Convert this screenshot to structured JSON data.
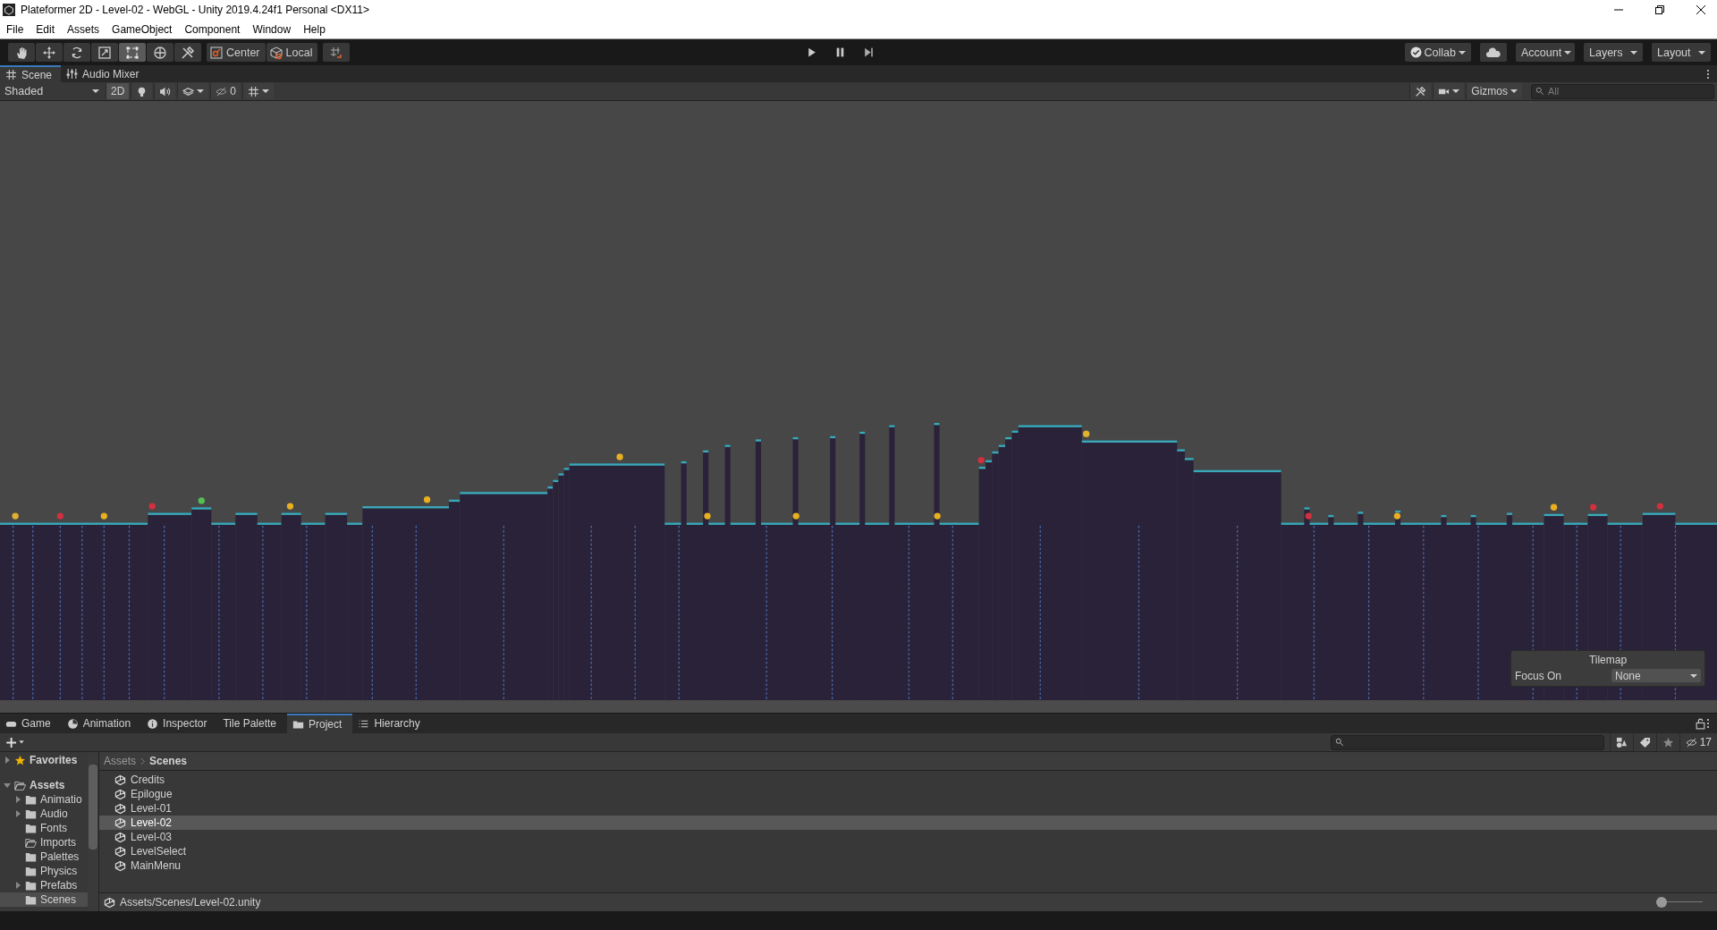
{
  "window": {
    "title": "Plateformer 2D - Level-02 - WebGL - Unity 2019.4.24f1 Personal <DX11>"
  },
  "menu": [
    "File",
    "Edit",
    "Assets",
    "GameObject",
    "Component",
    "Window",
    "Help"
  ],
  "tools": [
    {
      "kind": "hand",
      "selected": false
    },
    {
      "kind": "move",
      "selected": false
    },
    {
      "kind": "rotate",
      "selected": false
    },
    {
      "kind": "scale",
      "selected": false
    },
    {
      "kind": "rect",
      "selected": true
    },
    {
      "kind": "transform",
      "selected": false
    },
    {
      "kind": "custom",
      "selected": false
    }
  ],
  "pivot": [
    {
      "kind": "center",
      "label": "Center"
    },
    {
      "kind": "local",
      "label": "Local"
    }
  ],
  "right_buttons": [
    {
      "kind": "collab",
      "label": "Collab"
    },
    {
      "kind": "cloud"
    },
    {
      "kind": "dropdown",
      "label": "Account"
    },
    {
      "kind": "dropdown",
      "label": "Layers"
    },
    {
      "kind": "dropdown",
      "label": "Layout"
    }
  ],
  "scene_tabs": [
    {
      "kind": "scene",
      "label": "Scene",
      "selected": true
    },
    {
      "kind": "mixer",
      "label": "Audio Mixer",
      "selected": false
    }
  ],
  "scene_toolbar": {
    "draw_mode": "Shaded",
    "mode_2d": {
      "label": "2D",
      "on": true
    },
    "hidden_count": "0",
    "gizmos": "Gizmos",
    "search": {
      "placeholder": "All"
    }
  },
  "tilemap_overlay": {
    "title": "Tilemap",
    "label": "Focus On",
    "value": "None"
  },
  "bottom_tabs": [
    {
      "kind": "game",
      "label": "Game",
      "selected": false
    },
    {
      "kind": "animation",
      "label": "Animation",
      "selected": false
    },
    {
      "kind": "inspector",
      "label": "Inspector",
      "selected": false
    },
    {
      "kind": "none",
      "label": "Tile Palette",
      "selected": false
    },
    {
      "kind": "project",
      "label": "Project",
      "selected": true
    },
    {
      "kind": "hierarchy",
      "label": "Hierarchy",
      "selected": false
    }
  ],
  "project": {
    "hidden_count": "17",
    "favorites": {
      "label": "Favorites",
      "expanded": false
    },
    "tree": {
      "label": "Assets",
      "expanded": true,
      "children": [
        {
          "label": "Animatio",
          "has_children": true,
          "open_folder": false,
          "selected": false
        },
        {
          "label": "Audio",
          "has_children": true,
          "open_folder": false,
          "selected": false
        },
        {
          "label": "Fonts",
          "has_children": false,
          "open_folder": false,
          "selected": false
        },
        {
          "label": "Imports",
          "has_children": false,
          "open_folder": true,
          "selected": false
        },
        {
          "label": "Palettes",
          "has_children": false,
          "open_folder": false,
          "selected": false
        },
        {
          "label": "Physics",
          "has_children": false,
          "open_folder": false,
          "selected": false
        },
        {
          "label": "Prefabs",
          "has_children": true,
          "open_folder": false,
          "selected": false
        },
        {
          "label": "Scenes",
          "has_children": false,
          "open_folder": false,
          "selected": true
        }
      ]
    },
    "breadcrumb": [
      "Assets",
      "Scenes"
    ],
    "files": [
      {
        "name": "Credits",
        "selected": false
      },
      {
        "name": "Epilogue",
        "selected": false
      },
      {
        "name": "Level-01",
        "selected": false
      },
      {
        "name": "Level-02",
        "selected": true
      },
      {
        "name": "Level-03",
        "selected": false
      },
      {
        "name": "LevelSelect",
        "selected": false
      },
      {
        "name": "MainMenu",
        "selected": false
      }
    ],
    "path": "Assets/Scenes/Level-02.unity",
    "zoom": {
      "level": 0
    }
  }
}
